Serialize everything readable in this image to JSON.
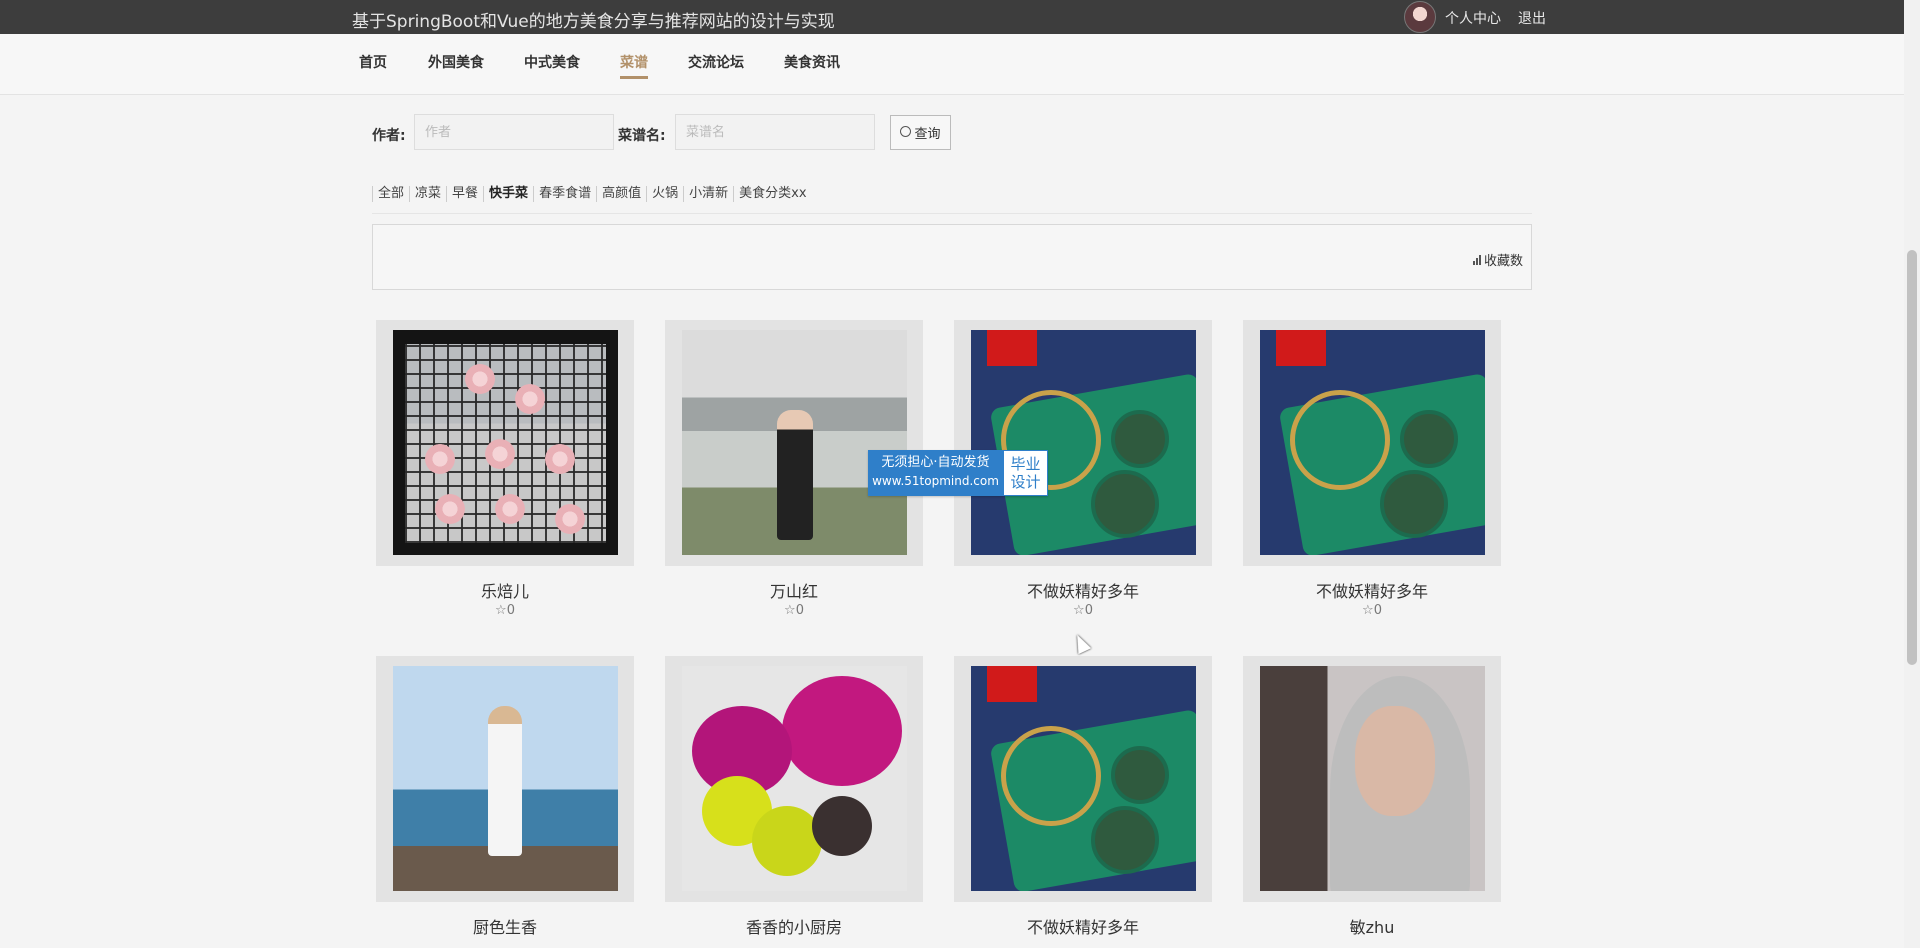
{
  "header": {
    "site_title": "基于SpringBoot和Vue的地方美食分享与推荐网站的设计与实现",
    "profile_label": "个人中心",
    "logout_label": "退出"
  },
  "nav": {
    "items": [
      {
        "label": "首页"
      },
      {
        "label": "外国美食"
      },
      {
        "label": "中式美食"
      },
      {
        "label": "菜谱",
        "active": true
      },
      {
        "label": "交流论坛"
      },
      {
        "label": "美食资讯"
      }
    ]
  },
  "search": {
    "author_label": "作者:",
    "author_placeholder": "作者",
    "name_label": "菜谱名:",
    "name_placeholder": "菜谱名",
    "button_label": "查询"
  },
  "categories": [
    "全部",
    "凉菜",
    "早餐",
    "快手菜",
    "春季食谱",
    "高颜值",
    "火锅",
    "小清新",
    "美食分类xx"
  ],
  "active_category": "快手菜",
  "sort": {
    "label": "收藏数"
  },
  "recipes": [
    {
      "name": "乐焙儿",
      "likes": "0",
      "image": "flowers"
    },
    {
      "name": "万山红",
      "likes": "0",
      "image": "bridge"
    },
    {
      "name": "不做妖精好多年",
      "likes": "0",
      "image": "tea"
    },
    {
      "name": "不做妖精好多年",
      "likes": "0",
      "image": "tea"
    },
    {
      "name": "厨色生香",
      "likes": "",
      "image": "beach"
    },
    {
      "name": "香香的小厨房",
      "likes": "",
      "image": "fruit"
    },
    {
      "name": "不做妖精好多年",
      "likes": "",
      "image": "tea"
    },
    {
      "name": "敏zhu",
      "likes": "",
      "image": "woman"
    }
  ],
  "watermark": {
    "line1": "无须担心·自动发货",
    "line2": "www.51topmind.com",
    "side1": "毕业",
    "side2": "设计"
  },
  "colors": {
    "topbar": "#3d3d3d",
    "accent": "#b2916a",
    "watermark_blue": "#2f7fc9"
  }
}
